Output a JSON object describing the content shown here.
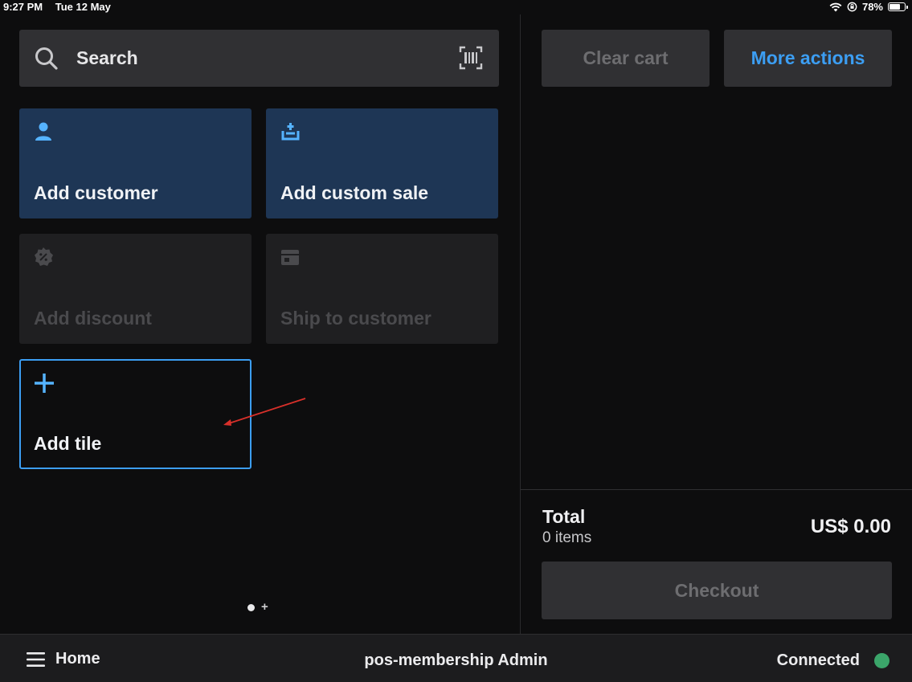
{
  "status_bar": {
    "time": "9:27 PM",
    "date": "Tue 12 May",
    "battery": "78%",
    "battery_level": 0.78,
    "icons": [
      "wifi-icon",
      "rotation-lock-icon",
      "battery-icon"
    ]
  },
  "search": {
    "placeholder": "Search",
    "icon": "search-icon",
    "scan_icon": "barcode-scan-icon"
  },
  "tiles": [
    {
      "label": "Add customer",
      "icon": "person-icon",
      "state": "enabled"
    },
    {
      "label": "Add custom sale",
      "icon": "custom-sale-icon",
      "state": "enabled"
    },
    {
      "label": "Add discount",
      "icon": "discount-icon",
      "state": "disabled"
    },
    {
      "label": "Ship to customer",
      "icon": "shipping-icon",
      "state": "disabled"
    },
    {
      "label": "Add tile",
      "icon": "plus-icon",
      "state": "outline"
    }
  ],
  "pager": {
    "page_count": 1,
    "current": 1
  },
  "cart": {
    "clear_label": "Clear cart",
    "more_label": "More actions",
    "total_label": "Total",
    "items_label": "0 items",
    "total_amount": "US$ 0.00",
    "checkout_label": "Checkout"
  },
  "bottom_bar": {
    "home_label": "Home",
    "app_title": "pos-membership Admin",
    "connection_label": "Connected"
  },
  "colors": {
    "accent": "#3c9ef3",
    "tile_blue": "#1e3655",
    "connected": "#3ba56a",
    "annotation_arrow": "#d8302a"
  }
}
